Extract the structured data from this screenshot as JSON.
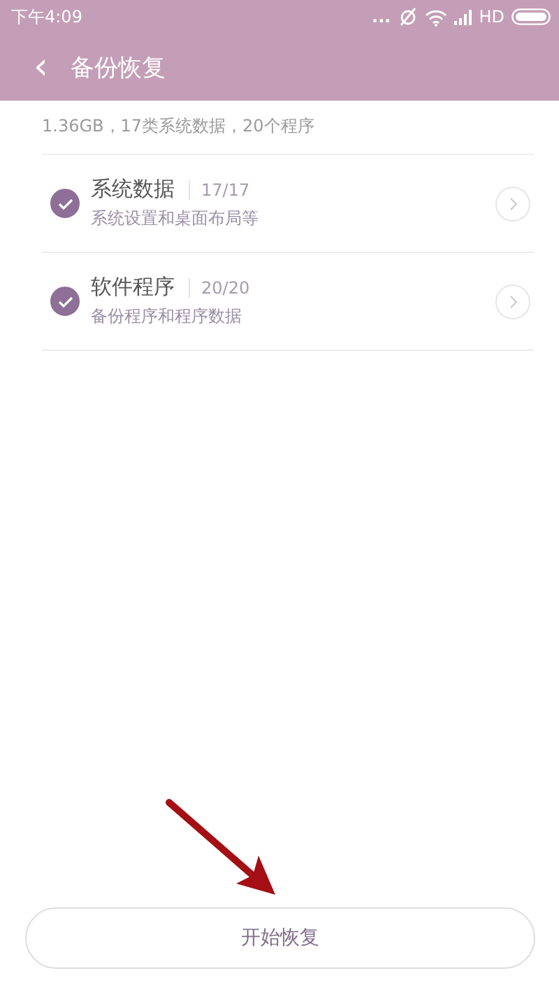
{
  "status_bar": {
    "time": "下午4:09",
    "dots": "...",
    "network": "HD"
  },
  "header": {
    "back": "‹",
    "title": "备份恢复"
  },
  "summary": "1.36GB，17类系统数据，20个程序",
  "items": [
    {
      "title": "系统数据",
      "count": "17/17",
      "subtitle": "系统设置和桌面布局等",
      "checked": true
    },
    {
      "title": "软件程序",
      "count": "20/20",
      "subtitle": "备份程序和程序数据",
      "checked": true
    }
  ],
  "button": {
    "label": "开始恢复"
  }
}
